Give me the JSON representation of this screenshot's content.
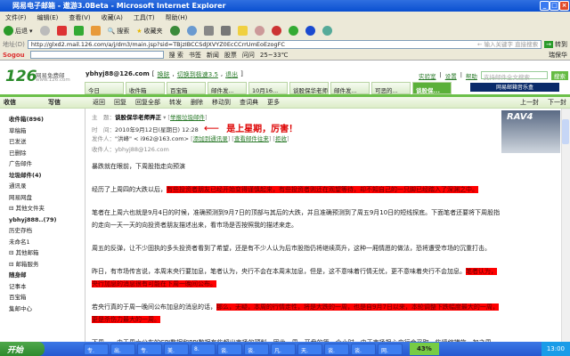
{
  "window": {
    "title": "网易电子邮箱 - 遨游3.0Beta - Microsoft Internet Explorer"
  },
  "menu": [
    "文件(F)",
    "编辑(E)",
    "查看(V)",
    "收藏(A)",
    "工具(T)",
    "帮助(H)"
  ],
  "toolbar": {
    "back": "后退",
    "search": "搜索",
    "favorites": "收藏夹"
  },
  "address": {
    "label": "地址(D)",
    "url": "http://glxd2.mail.126.com/a/j/dm3/main.jsp?sid=TBjzIBCCSdJXVYZ0EcCCrrUmEoEzogFC",
    "hint": "← 输入关键字 直接搜索",
    "go": "转到"
  },
  "searchbar": {
    "search_btn": "搜 索",
    "bookmarks": "书签",
    "news": "新闻",
    "stocks": "股票",
    "ask": "问问",
    "weather": "25~33℃",
    "security": "瑞保华"
  },
  "mail": {
    "logo": "126",
    "logo_sub": "网易免费邮",
    "logo_url": "www.126.com",
    "user": "ybhyj88@126.com",
    "user_links": [
      "换肤",
      "切换到极速3.5",
      "退出"
    ],
    "top_links": [
      "实验室",
      "设置",
      "帮助"
    ],
    "search_placeholder": "支持邮件全文搜索",
    "search_btn": "搜索",
    "music": "网易邮箱音乐盒",
    "tabs": [
      "今日",
      "收件箱",
      "百宝箱",
      "邮件发...",
      "10月16...",
      "谈股保华老师...",
      "邮件发...",
      "可恶的...",
      "谈股保..."
    ],
    "actions": [
      "收信",
      "写信",
      "返回",
      "回复",
      "回复全部",
      "转发",
      "删除",
      "移动到",
      "查词典",
      "更多"
    ],
    "nav": [
      "上一封",
      "下一封"
    ],
    "sidebar": [
      {
        "label": "收件箱(896)",
        "bold": true
      },
      {
        "label": "草稿箱"
      },
      {
        "label": "已发送"
      },
      {
        "label": "已删除"
      },
      {
        "label": "广告邮件"
      },
      {
        "label": "垃圾邮件(4)",
        "bold": true
      },
      {
        "label": "通讯录"
      },
      {
        "label": "网易网盘"
      },
      {
        "label": "⊟ 其他文件夹"
      },
      {
        "label": "ybhyj888..(79)",
        "bold": true
      },
      {
        "label": "历史存档"
      },
      {
        "label": "未命名1"
      },
      {
        "label": "⊟ 其他邮箱"
      },
      {
        "label": "⊟ 邮箱服务"
      },
      {
        "label": "随身邮",
        "bold": true
      },
      {
        "label": "记事本"
      },
      {
        "label": "百宝箱"
      },
      {
        "label": "集邮中心"
      }
    ],
    "message": {
      "subject_label": "主　题：",
      "subject": "谈股保华老师弄正",
      "report": "举报垃圾邮件",
      "time_label": "时　间：",
      "time": "2010年9月12日(星期日) 12:28",
      "annotation": "是上星期，厉害！",
      "from_label": "发件人：",
      "from": "\"洪峰\" <          i962@163.com>",
      "from_links": [
        "添加到通讯录",
        "查看邮件往来",
        "拒收"
      ],
      "to_label": "收件人：",
      "to": "ybhyj88@126.com",
      "paragraphs": [
        {
          "text": "暴跌就在眼前，下周股指走向预演"
        },
        {
          "text": "经历了上周四的大跌以后，",
          "hl": "有些投资者朋友已经开始变得谨慎起来，有些投资者则还在观望等待，却不知自己的一只脚已经踏入了深渊之中。"
        },
        {
          "text": "笔者在上周六也就是9月4日的时候，准确预测到9月7日的顶部与其后的大跌，并且准确预测到了周五9月10日的短线探底。下面笔者还要将下周股指的走向一天一天的向投资者朋友描述出来，看市场是否按照我的描述来走。"
        },
        {
          "text": "周五的反弹，让不少固执的多头投资者看到了希望，还是有不少人认为后市股指仍将继续高升，这种一厢情愿的做法，恐将遭受市场的沉重打击。"
        },
        {
          "text": "昨日，有市场传言说，本周末央行要加息，笔者认为，央行不会在本周末加息，但是，这不意味着行情无忧，更不意味着央行不会加息。",
          "hl": "笔者认为，央行加息的消息很有可能在下周一晚间公布。"
        },
        {
          "text": "若央行真的于周一晚间公布加息的消息的话，",
          "hl": "那么，无疑，本周的行情走性，将是大跌的一周，也是自9月7日以来，本轮调整下跌幅度最大的一周，更是杀伤力最大的一周。"
        },
        {
          "text": "下周一，由于周六公布的CPI数据和PPI数据有些超出市场的预料，因此，周一开盘的第一个小时，由于市场担心央行会采取一些紧缩措施，加之周"
        }
      ]
    },
    "ad": "RAV4"
  },
  "taskbar": {
    "start": "开始",
    "tasks": [
      "专.",
      "出.",
      "专.",
      "美.",
      "8.",
      "谈.",
      "谈.",
      "凡.",
      "天.",
      "谈.",
      "谈.",
      "网."
    ],
    "percent": "43%",
    "clock": "13:00"
  }
}
